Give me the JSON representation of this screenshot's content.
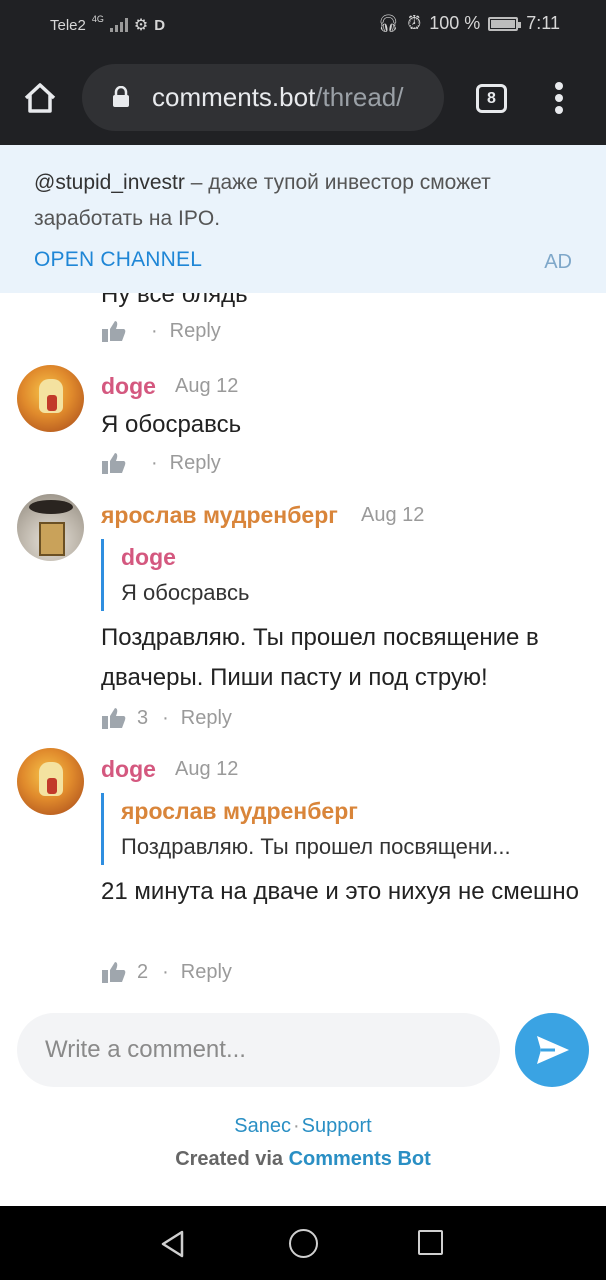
{
  "status_bar": {
    "carrier": "Tele2",
    "network": "4G",
    "percent": "100 %",
    "time": "7:11"
  },
  "browser": {
    "url_host": "comments.bot",
    "url_path": "/thread/",
    "tab_count": "8"
  },
  "ad": {
    "handle": "@stupid_investr",
    "text": " – даже тупой инвестор сможет заработать на IPO.",
    "open_label": "OPEN CHANNEL",
    "badge": "AD"
  },
  "comments": [
    {
      "body": "Ну все блядь",
      "likes": "",
      "reply_label": "Reply"
    },
    {
      "author": "doge",
      "date": "Aug 12",
      "body": "Я обосравсь",
      "likes": "",
      "reply_label": "Reply"
    },
    {
      "author": "ярослав мудренберг",
      "date": "Aug 12",
      "quote_author": "doge",
      "quote_text": "Я обосравсь",
      "body": "Поздравляю. Ты прошел посвящение в двачеры. Пиши пасту и под струю!",
      "likes": "3",
      "reply_label": "Reply"
    },
    {
      "author": "doge",
      "date": "Aug 12",
      "quote_author": "ярослав мудренберг",
      "quote_text": "Поздравляю. Ты прошел посвящени...",
      "body": "21 минута на дваче и это нихуя не смешно",
      "likes": "2",
      "reply_label": "Reply"
    }
  ],
  "composer": {
    "placeholder": "Write a comment..."
  },
  "footer": {
    "link1": "Sanec",
    "link2": "Support",
    "created_prefix": "Created via ",
    "created_brand": "Comments Bot"
  },
  "colors": {
    "accent": "#1f86d6",
    "doge": "#d4587f",
    "yaroslav": "#d9853a",
    "send": "#3aa3e3"
  }
}
